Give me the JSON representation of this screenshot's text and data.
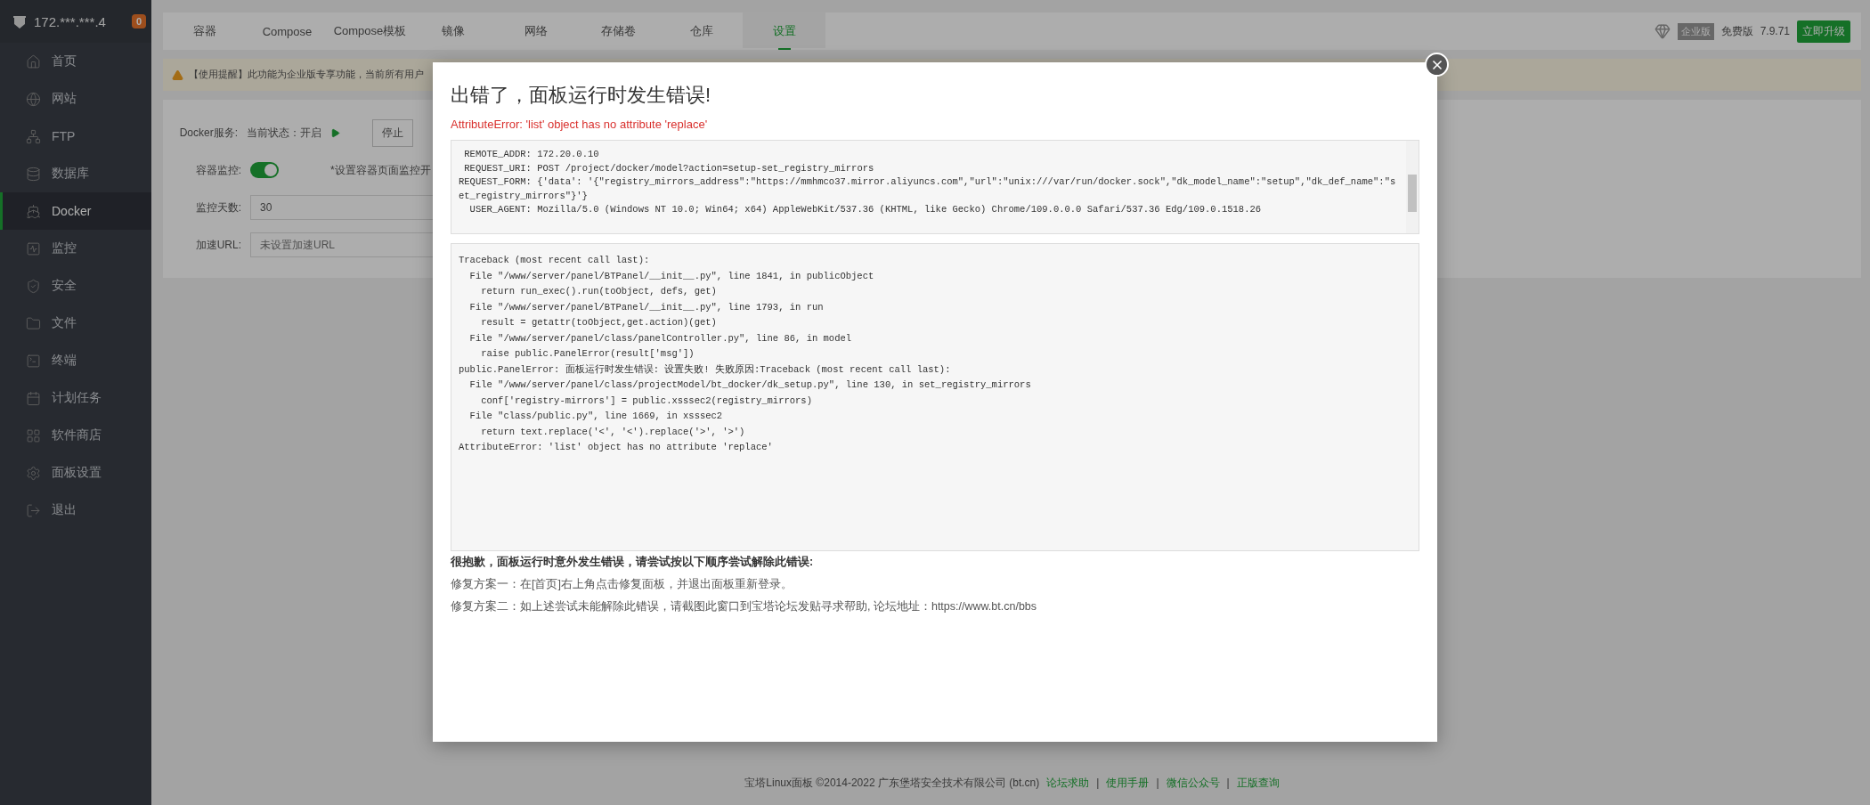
{
  "sidebar": {
    "host": "172.***.***.4",
    "badge": "0",
    "items": [
      {
        "label": "首页",
        "selected": false
      },
      {
        "label": "网站",
        "selected": false
      },
      {
        "label": "FTP",
        "selected": false
      },
      {
        "label": "数据库",
        "selected": false
      },
      {
        "label": "Docker",
        "selected": true
      },
      {
        "label": "监控",
        "selected": false
      },
      {
        "label": "安全",
        "selected": false
      },
      {
        "label": "文件",
        "selected": false
      },
      {
        "label": "终端",
        "selected": false
      },
      {
        "label": "计划任务",
        "selected": false
      },
      {
        "label": "软件商店",
        "selected": false
      },
      {
        "label": "面板设置",
        "selected": false
      },
      {
        "label": "退出",
        "selected": false
      }
    ]
  },
  "tabs": [
    {
      "label": "容器",
      "selected": false
    },
    {
      "label": "Compose",
      "selected": false
    },
    {
      "label": "Compose模板",
      "selected": false
    },
    {
      "label": "镜像",
      "selected": false
    },
    {
      "label": "网络",
      "selected": false
    },
    {
      "label": "存储卷",
      "selected": false
    },
    {
      "label": "仓库",
      "selected": false
    },
    {
      "label": "设置",
      "selected": true
    }
  ],
  "version": {
    "edition": "企业版",
    "plan": "免费版",
    "number": "7.9.71",
    "upgrade": "立即升级"
  },
  "notice": "【使用提醒】此功能为企业版专享功能，当前所有用户",
  "settings": {
    "service_label": "Docker服务:",
    "status": "当前状态：开启",
    "stop_button": "停止",
    "monitor_label": "容器监控:",
    "monitor_on": true,
    "monitor_hint": "*设置容器页面监控开",
    "days_label": "监控天数:",
    "days_value": "30",
    "url_label": "加速URL:",
    "url_placeholder": "未设置加速URL"
  },
  "dialog": {
    "title": "出错了，面板运行时发生错误!",
    "error": "AttributeError: 'list' object has no attribute 'replace'",
    "request_lines": [
      " REMOTE_ADDR: 172.20.0.10",
      " REQUEST_URI: POST /project/docker/model?action=setup-set_registry_mirrors",
      "REQUEST_FORM: {'data': '{\"registry_mirrors_address\":\"https://mmhmco37.mirror.aliyuncs.com\",\"url\":\"unix:///var/run/docker.sock\",\"dk_model_name\":\"setup\",\"dk_def_name\":\"set_registry_mirrors\"}'}",
      "  USER_AGENT: Mozilla/5.0 (Windows NT 10.0; Win64; x64) AppleWebKit/537.36 (KHTML, like Gecko) Chrome/109.0.0.0 Safari/537.36 Edg/109.0.1518.26"
    ],
    "traceback": [
      "Traceback (most recent call last):",
      "  File \"/www/server/panel/BTPanel/__init__.py\", line 1841, in publicObject",
      "    return run_exec().run(toObject, defs, get)",
      "  File \"/www/server/panel/BTPanel/__init__.py\", line 1793, in run",
      "    result = getattr(toObject,get.action)(get)",
      "  File \"/www/server/panel/class/panelController.py\", line 86, in model",
      "    raise public.PanelError(result['msg'])",
      "public.PanelError: 面板运行时发生错误: 设置失败! 失败原因:Traceback (most recent call last):",
      "  File \"/www/server/panel/class/projectModel/bt_docker/dk_setup.py\", line 130, in set_registry_mirrors",
      "    conf['registry-mirrors'] = public.xsssec2(registry_mirrors)",
      "  File \"class/public.py\", line 1669, in xsssec2",
      "    return text.replace('<', '<').replace('>', '>')",
      "AttributeError: 'list' object has no attribute 'replace'"
    ],
    "help_title": "很抱歉，面板运行时意外发生错误，请尝试按以下顺序尝试解除此错误:",
    "help_lines": [
      "修复方案一：在[首页]右上角点击修复面板，并退出面板重新登录。",
      "修复方案二：如上述尝试未能解除此错误，请截图此窗口到宝塔论坛发贴寻求帮助, 论坛地址：https://www.bt.cn/bbs"
    ]
  },
  "footer": {
    "copyright": "宝塔Linux面板 ©2014-2022 广东堡塔安全技术有限公司 (bt.cn)",
    "links": [
      "论坛求助",
      "使用手册",
      "微信公众号",
      "正版查询"
    ],
    "separators": [
      "|",
      "|",
      "|"
    ]
  }
}
